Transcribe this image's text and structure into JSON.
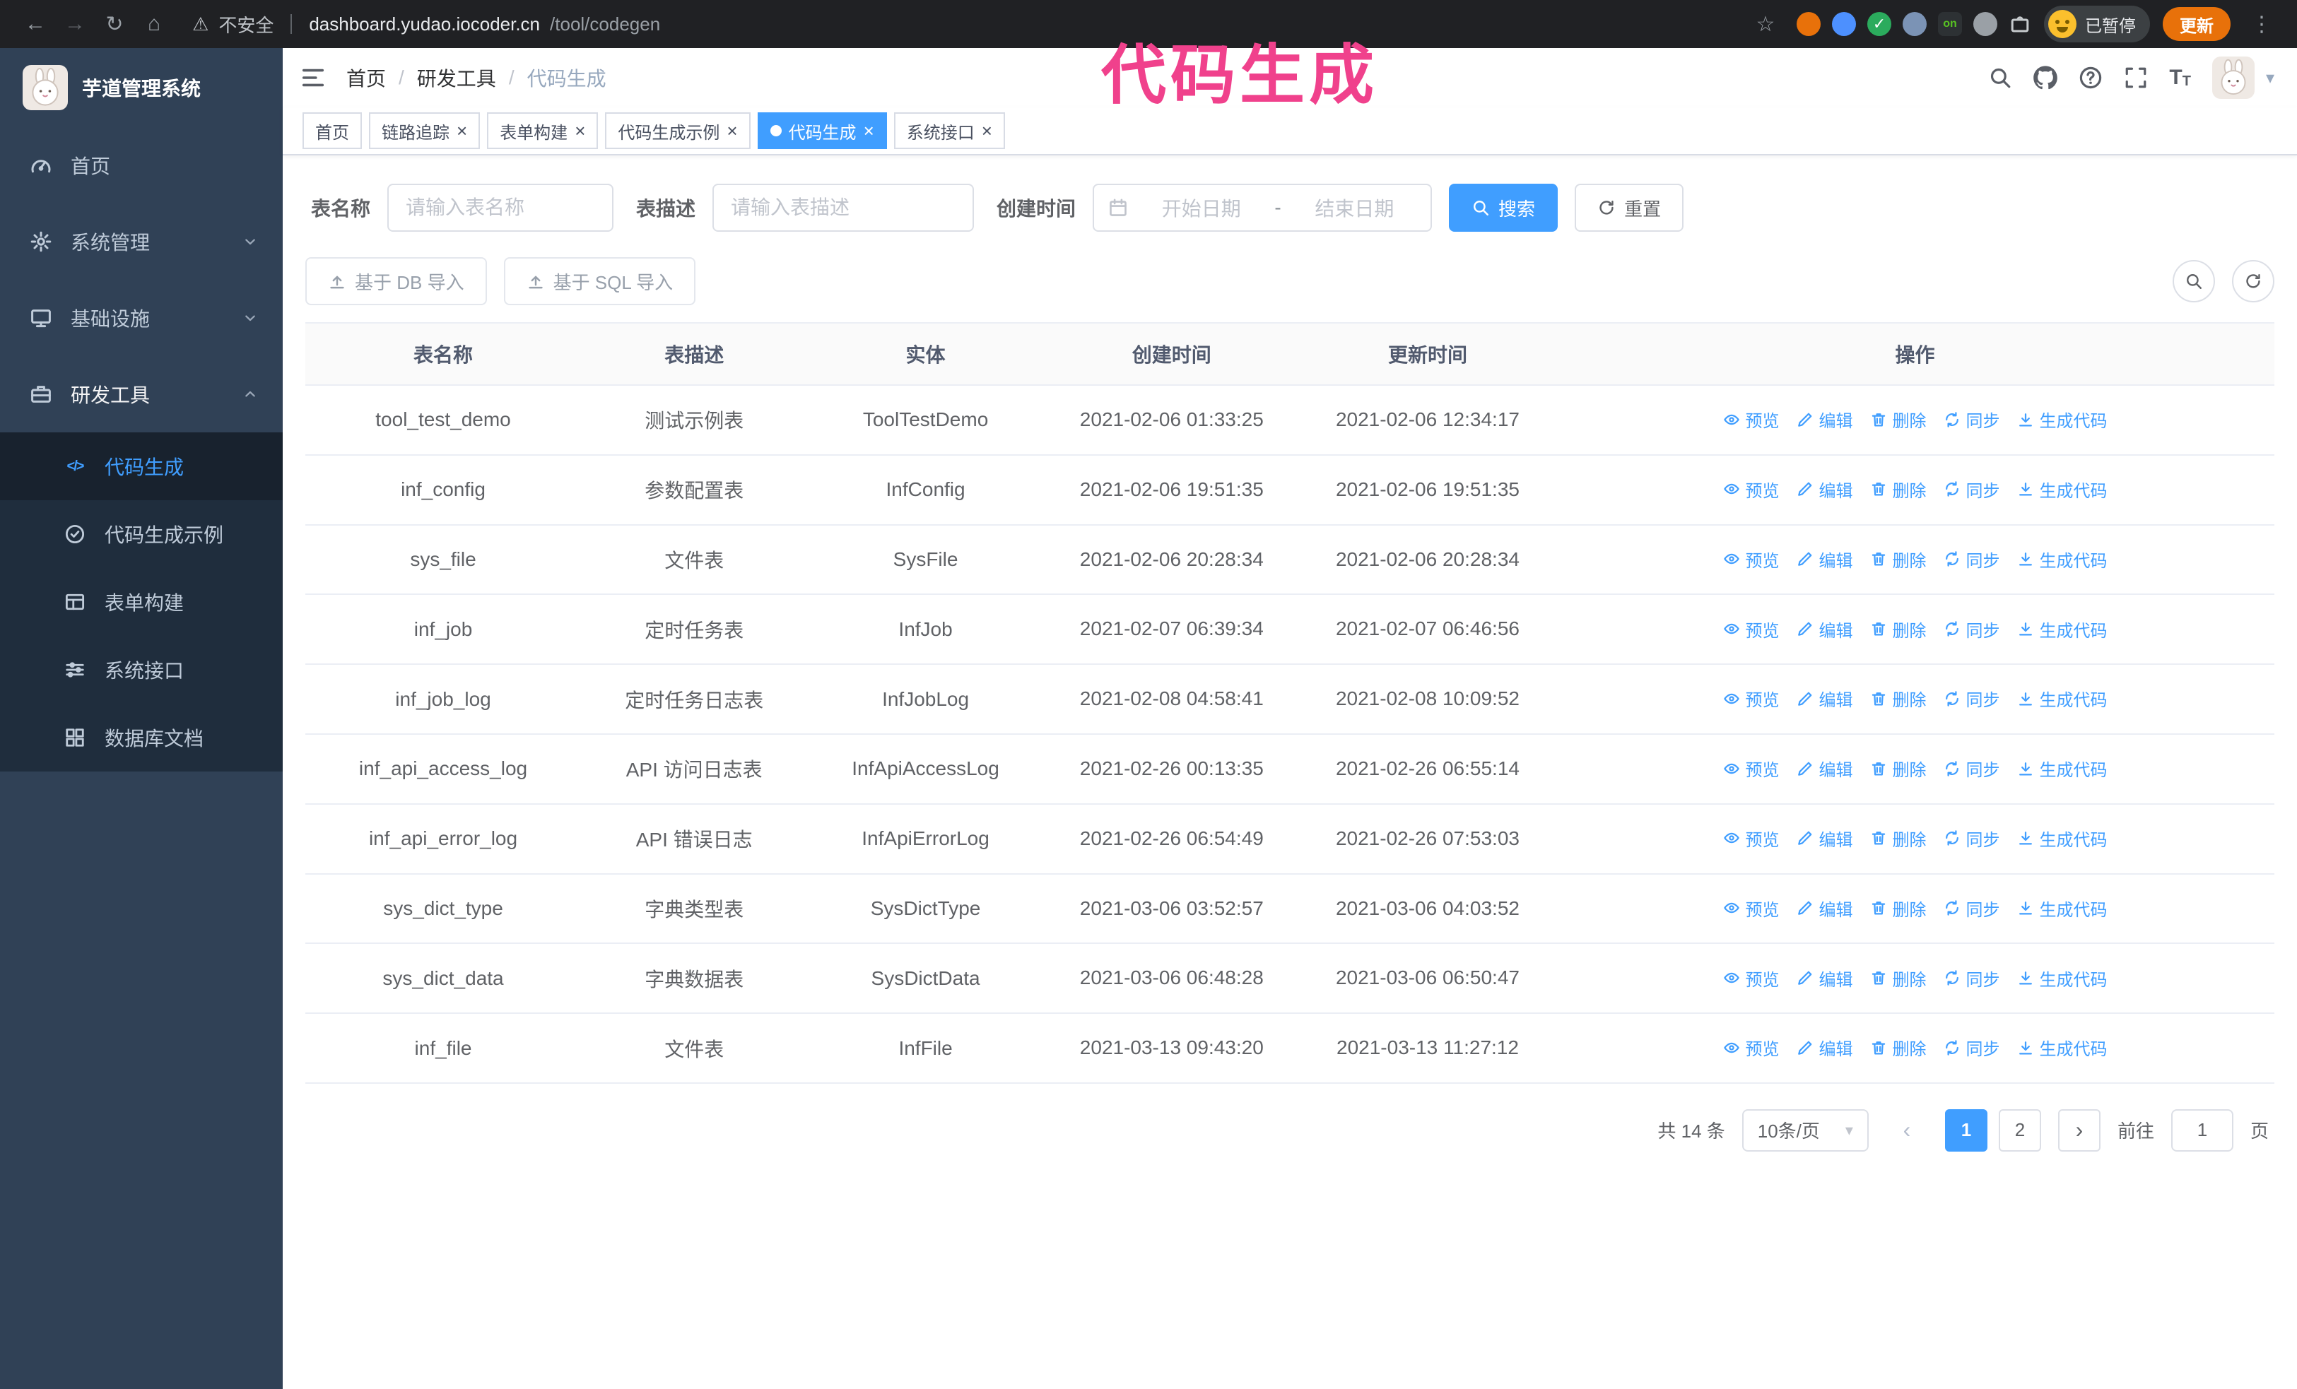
{
  "colors": {
    "accent": "#409eff",
    "sidebar_bg": "#304156",
    "submenu_bg": "#1f2d3d",
    "annotation": "#f0418c"
  },
  "annotation": {
    "text": "代码生成"
  },
  "browser": {
    "security_warning": "不安全",
    "url_host": "dashboard.yudao.iocoder.cn",
    "url_path": "/tool/codegen",
    "paused_badge": "已暂停",
    "update_button": "更新",
    "extensions": [
      {
        "name": "extension-icon-orange",
        "shape": "circle",
        "color": "#e8710a"
      },
      {
        "name": "extension-icon-blue",
        "shape": "circle",
        "color": "#4d90fe"
      },
      {
        "name": "extension-icon-green-check",
        "shape": "circle",
        "color": "#2bab5d",
        "glyph": "✓",
        "glyph_color": "#ffffff"
      },
      {
        "name": "extension-icon-people",
        "shape": "circle",
        "color": "#7b93b5"
      },
      {
        "name": "extension-icon-on-badge",
        "shape": "square",
        "color": "#2d3134",
        "glyph": "on",
        "glyph_color": "#58c322"
      },
      {
        "name": "extension-icon-gray",
        "shape": "circle",
        "color": "#9aa0a6"
      },
      {
        "name": "extensions-puzzle-icon",
        "shape": "puzzle",
        "color": "#c6cacd"
      }
    ]
  },
  "sidebar": {
    "title": "芋道管理系统",
    "items": [
      {
        "name": "sidebar-item-home",
        "icon": "gauge",
        "label": "首页"
      },
      {
        "name": "sidebar-item-system",
        "icon": "gear",
        "label": "系统管理",
        "chevron": "down"
      },
      {
        "name": "sidebar-item-infra",
        "icon": "monitor",
        "label": "基础设施",
        "chevron": "down"
      },
      {
        "name": "sidebar-item-devtools",
        "icon": "toolbox",
        "label": "研发工具",
        "chevron": "up",
        "expanded": true
      }
    ],
    "subitems": [
      {
        "name": "sidebar-subitem-codegen",
        "icon": "code",
        "label": "代码生成",
        "active": true
      },
      {
        "name": "sidebar-subitem-codegen-example",
        "icon": "badge",
        "label": "代码生成示例"
      },
      {
        "name": "sidebar-subitem-form-builder",
        "icon": "form",
        "label": "表单构建"
      },
      {
        "name": "sidebar-subitem-system-api",
        "icon": "api",
        "label": "系统接口"
      },
      {
        "name": "sidebar-subitem-db-doc",
        "icon": "dbdoc",
        "label": "数据库文档"
      }
    ]
  },
  "navbar": {
    "breadcrumb": [
      "首页",
      "研发工具",
      "代码生成"
    ],
    "separator": "/"
  },
  "tags": [
    {
      "name": "tag-home",
      "label": "首页"
    },
    {
      "name": "tag-tracing",
      "label": "链路追踪",
      "closable": true
    },
    {
      "name": "tag-form-builder",
      "label": "表单构建",
      "closable": true
    },
    {
      "name": "tag-codegen-example",
      "label": "代码生成示例",
      "closable": true
    },
    {
      "name": "tag-codegen",
      "label": "代码生成",
      "closable": true,
      "active": true
    },
    {
      "name": "tag-system-api",
      "label": "系统接口",
      "closable": true
    }
  ],
  "filters": {
    "table_name_label": "表名称",
    "table_name_placeholder": "请输入表名称",
    "table_desc_label": "表描述",
    "table_desc_placeholder": "请输入表描述",
    "create_time_label": "创建时间",
    "start_date_placeholder": "开始日期",
    "range_separator": "-",
    "end_date_placeholder": "结束日期",
    "search_button": "搜索",
    "reset_button": "重置"
  },
  "toolbar": {
    "import_db_button": "基于 DB 导入",
    "import_sql_button": "基于 SQL 导入"
  },
  "table": {
    "columns": [
      "表名称",
      "表描述",
      "实体",
      "创建时间",
      "更新时间",
      "操作"
    ],
    "actions": [
      {
        "name": "preview-link",
        "icon": "eye",
        "label": "预览"
      },
      {
        "name": "edit-link",
        "icon": "edit",
        "label": "编辑"
      },
      {
        "name": "delete-link",
        "icon": "trash",
        "label": "删除"
      },
      {
        "name": "sync-link",
        "icon": "sync",
        "label": "同步"
      },
      {
        "name": "generate-code-link",
        "icon": "download",
        "label": "生成代码"
      }
    ],
    "rows": [
      {
        "name": "tool_test_demo",
        "desc": "测试示例表",
        "entity": "ToolTestDemo",
        "created": "2021-02-06 01:33:25",
        "updated": "2021-02-06 12:34:17"
      },
      {
        "name": "inf_config",
        "desc": "参数配置表",
        "entity": "InfConfig",
        "created": "2021-02-06 19:51:35",
        "updated": "2021-02-06 19:51:35"
      },
      {
        "name": "sys_file",
        "desc": "文件表",
        "entity": "SysFile",
        "created": "2021-02-06 20:28:34",
        "updated": "2021-02-06 20:28:34"
      },
      {
        "name": "inf_job",
        "desc": "定时任务表",
        "entity": "InfJob",
        "created": "2021-02-07 06:39:34",
        "updated": "2021-02-07 06:46:56"
      },
      {
        "name": "inf_job_log",
        "desc": "定时任务日志表",
        "entity": "InfJobLog",
        "created": "2021-02-08 04:58:41",
        "updated": "2021-02-08 10:09:52"
      },
      {
        "name": "inf_api_access_log",
        "desc": "API 访问日志表",
        "entity": "InfApiAccessLog",
        "created": "2021-02-26 00:13:35",
        "updated": "2021-02-26 06:55:14"
      },
      {
        "name": "inf_api_error_log",
        "desc": "API 错误日志",
        "entity": "InfApiErrorLog",
        "created": "2021-02-26 06:54:49",
        "updated": "2021-02-26 07:53:03"
      },
      {
        "name": "sys_dict_type",
        "desc": "字典类型表",
        "entity": "SysDictType",
        "created": "2021-03-06 03:52:57",
        "updated": "2021-03-06 04:03:52"
      },
      {
        "name": "sys_dict_data",
        "desc": "字典数据表",
        "entity": "SysDictData",
        "created": "2021-03-06 06:48:28",
        "updated": "2021-03-06 06:50:47"
      },
      {
        "name": "inf_file",
        "desc": "文件表",
        "entity": "InfFile",
        "created": "2021-03-13 09:43:20",
        "updated": "2021-03-13 11:27:12"
      }
    ]
  },
  "pagination": {
    "total": "共 14 条",
    "page_size": "10条/页",
    "pages": [
      "1",
      "2"
    ],
    "current": "1",
    "goto_label": "前往",
    "goto_value": "1",
    "goto_suffix": "页"
  }
}
